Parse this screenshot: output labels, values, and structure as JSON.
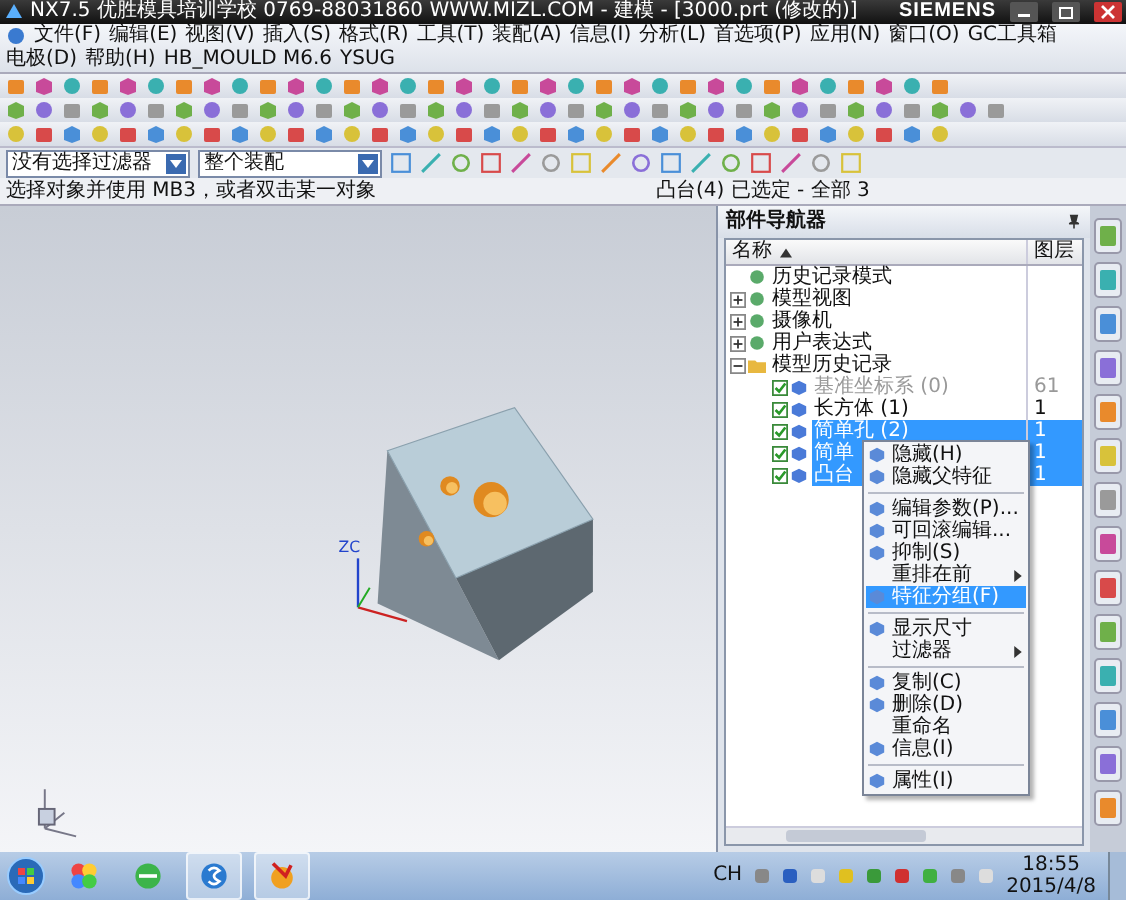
{
  "window": {
    "title": "NX7.5 优胜模具培训学校 0769-88031860 WWW.MIZL.COM - 建模 - [3000.prt (修改的)]",
    "brand": "SIEMENS"
  },
  "menu": [
    "文件(F)",
    "编辑(E)",
    "视图(V)",
    "插入(S)",
    "格式(R)",
    "工具(T)",
    "装配(A)",
    "信息(I)",
    "分析(L)",
    "首选项(P)",
    "应用(N)",
    "窗口(O)",
    "GC工具箱",
    "电极(D)",
    "帮助(H)",
    "HB_MOULD M6.6",
    "YSUG"
  ],
  "selection_bar": {
    "filter": "没有选择过滤器",
    "scope": "整个装配"
  },
  "prompt": "选择对象并使用 MB3，或者双击某一对象",
  "status": "凸台(4) 已选定 - 全部 3",
  "graphic": {
    "axis_label": "ZC"
  },
  "navigator": {
    "title": "部件导航器",
    "columns": [
      "名称",
      "图层"
    ],
    "tree": [
      {
        "label": "历史记录模式",
        "selected": false
      },
      {
        "label": "模型视图",
        "expanded": false,
        "selected": false
      },
      {
        "label": "摄像机",
        "expanded": false,
        "selected": false
      },
      {
        "label": "用户表达式",
        "expanded": false,
        "selected": false
      },
      {
        "label": "模型历史记录",
        "expanded": true,
        "selected": false,
        "children": [
          {
            "label": "基准坐标系 (0)",
            "layer": "61",
            "checked": true,
            "disabled": true,
            "selected": false
          },
          {
            "label": "长方体 (1)",
            "layer": "1",
            "checked": true,
            "disabled": false,
            "selected": false
          },
          {
            "label": "简单孔 (2)",
            "layer": "1",
            "checked": true,
            "disabled": false,
            "selected": true
          },
          {
            "label": "简单",
            "layer": "1",
            "checked": true,
            "disabled": false,
            "selected": true
          },
          {
            "label": "凸台",
            "layer": "1",
            "checked": true,
            "disabled": false,
            "selected": true
          }
        ]
      }
    ]
  },
  "context_menu": [
    {
      "kind": "item",
      "label": "隐藏(H)",
      "icon": true,
      "selected": false
    },
    {
      "kind": "item",
      "label": "隐藏父特征",
      "icon": true,
      "selected": false
    },
    {
      "kind": "separator"
    },
    {
      "kind": "item",
      "label": "编辑参数(P)...",
      "icon": true,
      "selected": false
    },
    {
      "kind": "item",
      "label": "可回滚编辑...",
      "icon": true,
      "selected": false
    },
    {
      "kind": "item",
      "label": "抑制(S)",
      "icon": true,
      "selected": false
    },
    {
      "kind": "submenu",
      "label": "重排在前",
      "icon": false,
      "selected": false
    },
    {
      "kind": "item",
      "label": "特征分组(F)",
      "icon": true,
      "selected": true
    },
    {
      "kind": "separator"
    },
    {
      "kind": "item",
      "label": "显示尺寸",
      "icon": true,
      "selected": false
    },
    {
      "kind": "submenu",
      "label": "过滤器",
      "icon": false,
      "selected": false
    },
    {
      "kind": "separator"
    },
    {
      "kind": "item",
      "label": "复制(C)",
      "icon": true,
      "selected": false
    },
    {
      "kind": "item",
      "label": "删除(D)",
      "icon": true,
      "selected": false
    },
    {
      "kind": "item",
      "label": "重命名",
      "icon": false,
      "selected": false
    },
    {
      "kind": "item",
      "label": "信息(I)",
      "icon": true,
      "selected": false
    },
    {
      "kind": "separator"
    },
    {
      "kind": "item",
      "label": "属性(I)",
      "icon": true,
      "selected": false
    }
  ],
  "taskbar": {
    "language": "CH",
    "time": "18:55",
    "date": "2015/4/8"
  }
}
